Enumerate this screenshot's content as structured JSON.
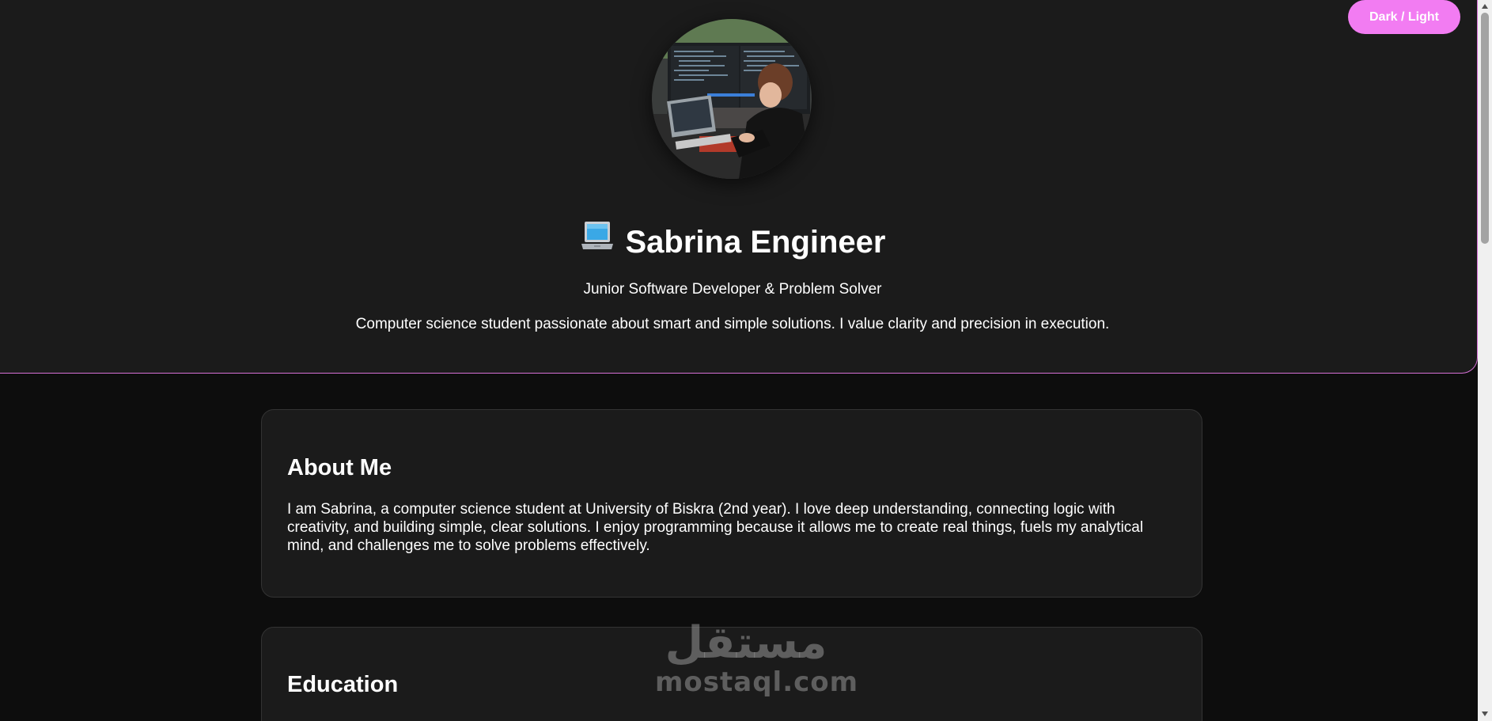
{
  "theme_toggle": {
    "label": "Dark / Light"
  },
  "hero": {
    "icon": "laptop-icon",
    "name": "Sabrina Engineer",
    "subtitle": "Junior Software Developer & Problem Solver",
    "tagline": "Computer science student passionate about smart and simple solutions. I value clarity and precision in execution."
  },
  "about": {
    "heading": "About Me",
    "body": "I am Sabrina, a computer science student at University of Biskra (2nd year). I love deep understanding, connecting logic with creativity, and building simple, clear solutions. I enjoy programming because it allows me to create real things, fuels my analytical mind, and challenges me to solve problems effectively."
  },
  "education": {
    "heading": "Education"
  },
  "watermark": {
    "arabic": "مستقل",
    "latin": "mostaql.com"
  },
  "colors": {
    "accent": "#f27cf2",
    "border_accent": "#d670d6",
    "card_bg": "#1b1b1b",
    "page_bg": "#0d0d0d"
  }
}
